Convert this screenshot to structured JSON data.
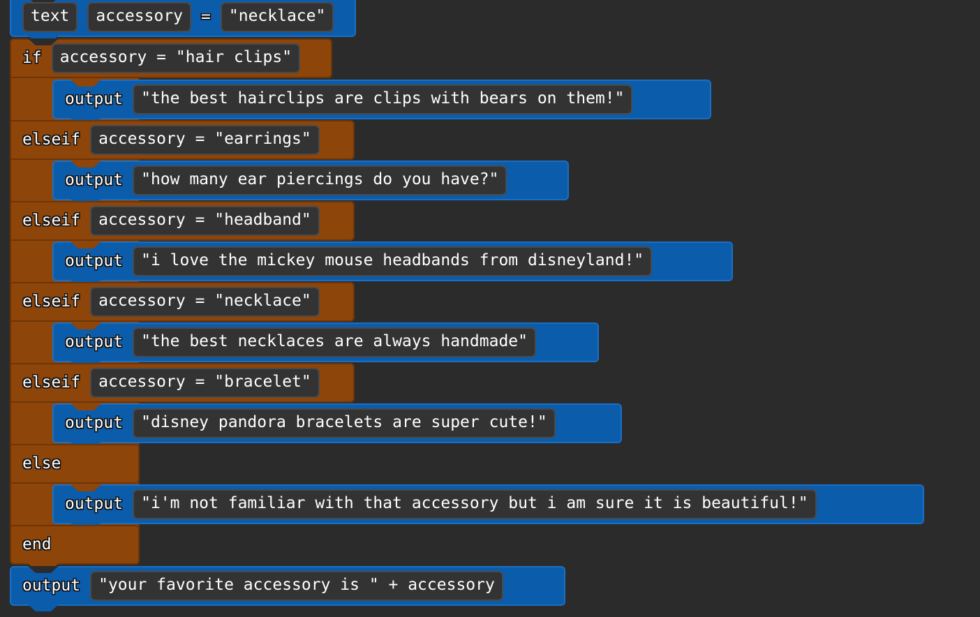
{
  "editor": {
    "name": "block-code-editor",
    "background_color": "#2b2b2b",
    "statement_block_color": "#0b5cab",
    "control_block_color": "#8e450a",
    "field_color": "#333333"
  },
  "program": {
    "declaration": {
      "type_keyword": "text",
      "variable_name": "accessory",
      "assign_operator": "=",
      "value": "\"necklace\""
    },
    "conditional": {
      "if_keyword": "if",
      "if_condition": "accessory = \"hair clips\"",
      "if_body": {
        "keyword": "output",
        "value": "\"the best hairclips are clips with bears on them!\""
      },
      "branches": [
        {
          "keyword": "elseif",
          "condition": "accessory = \"earrings\"",
          "body": {
            "keyword": "output",
            "value": "\"how many ear piercings do you have?\""
          }
        },
        {
          "keyword": "elseif",
          "condition": "accessory = \"headband\"",
          "body": {
            "keyword": "output",
            "value": "\"i love the mickey mouse headbands from disneyland!\""
          }
        },
        {
          "keyword": "elseif",
          "condition": "accessory = \"necklace\"",
          "body": {
            "keyword": "output",
            "value": "\"the best necklaces are always handmade\""
          }
        },
        {
          "keyword": "elseif",
          "condition": "accessory = \"bracelet\"",
          "body": {
            "keyword": "output",
            "value": "\"disney pandora bracelets are super cute!\""
          }
        }
      ],
      "else_keyword": "else",
      "else_body": {
        "keyword": "output",
        "value": "\"i'm not familiar with that accessory but i am sure it is beautiful!\""
      },
      "end_keyword": "end"
    },
    "final_output": {
      "keyword": "output",
      "value": "\"your favorite accessory is \" + accessory"
    }
  }
}
